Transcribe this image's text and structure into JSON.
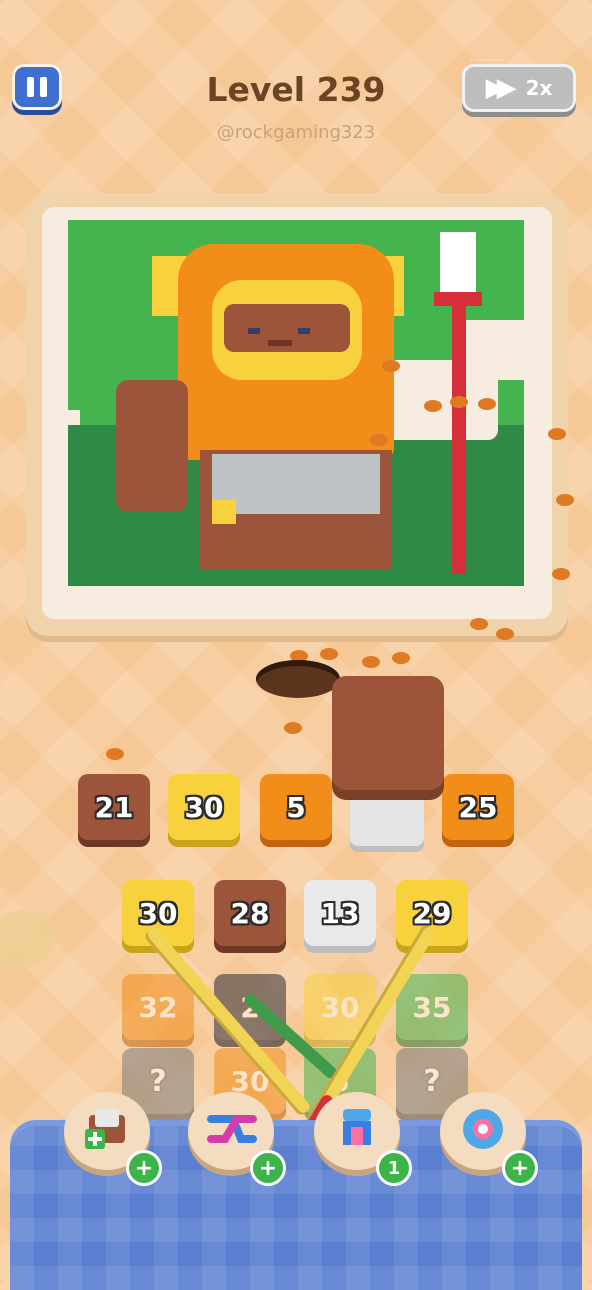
{
  "header": {
    "level_title": "Level 239",
    "username": "@rockgaming323",
    "speed_label": "2x",
    "speed_badge_text": "............"
  },
  "colors": {
    "yellow": "#f7d23c",
    "orange": "#f38d1a",
    "brown": "#9c553b",
    "white": "#e9e9e9",
    "green": "#46b451",
    "dark": "#2f2d3a",
    "gray": "#7d7d7d"
  },
  "slots": [
    {
      "value": "21",
      "color": "brown"
    },
    {
      "value": "30",
      "color": "yellow"
    },
    {
      "value": "5",
      "color": "orange"
    },
    {
      "value": "",
      "color": "white"
    },
    {
      "value": "25",
      "color": "orange"
    }
  ],
  "grid": [
    [
      {
        "value": "30",
        "color": "yellow"
      },
      {
        "value": "28",
        "color": "brown"
      },
      {
        "value": "13",
        "color": "white"
      },
      {
        "value": "29",
        "color": "yellow"
      }
    ],
    [
      {
        "value": "32",
        "color": "orange",
        "dim": true
      },
      {
        "value": "2",
        "color": "dark",
        "dim": true
      },
      {
        "value": "30",
        "color": "yellow",
        "dim": true
      },
      {
        "value": "35",
        "color": "green",
        "dim": true
      }
    ],
    [
      {
        "value": "?",
        "color": "gray",
        "dim": true
      },
      {
        "value": "30",
        "color": "orange",
        "dim": true
      },
      {
        "value": "5",
        "color": "green",
        "dim": true
      },
      {
        "value": "?",
        "color": "gray",
        "dim": true
      }
    ]
  ],
  "boosters": [
    {
      "name": "add-slot",
      "badge": "+"
    },
    {
      "name": "shuffle",
      "badge": "+"
    },
    {
      "name": "magnet",
      "badge": "1"
    },
    {
      "name": "freeze",
      "badge": "+"
    }
  ]
}
